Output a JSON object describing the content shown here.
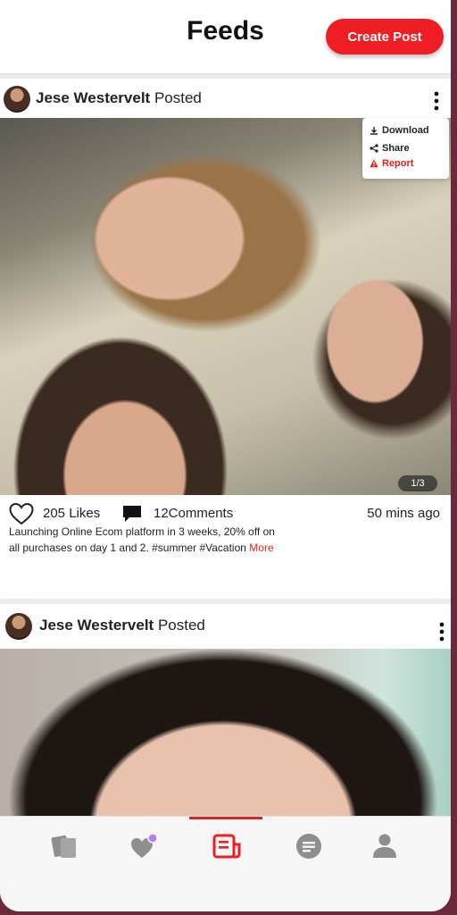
{
  "header": {
    "title": "Feeds",
    "create_post_label": "Create Post"
  },
  "posts": [
    {
      "author": "Jese Westervelt",
      "action": "Posted",
      "image_counter": "1/3",
      "likes": "205 Likes",
      "comments": "12Comments",
      "time": "50 mins ago",
      "caption": "Launching Online Ecom platform in 3 weeks, 20% off on all purchases on day 1 and 2. #summer #Vacation",
      "more_label": "More",
      "menu": {
        "download": "Download",
        "share": "Share",
        "report": "Report"
      }
    },
    {
      "author": "Jese Westervelt",
      "action": "Posted"
    }
  ],
  "bottom_nav": {
    "items": [
      "cards-icon",
      "heart-badge-icon",
      "feed-icon",
      "chat-icon",
      "profile-icon"
    ],
    "active_index": 2
  },
  "colors": {
    "accent": "#f01d24",
    "icon_grey": "#8e8e8e",
    "badge": "#b77cf0"
  }
}
